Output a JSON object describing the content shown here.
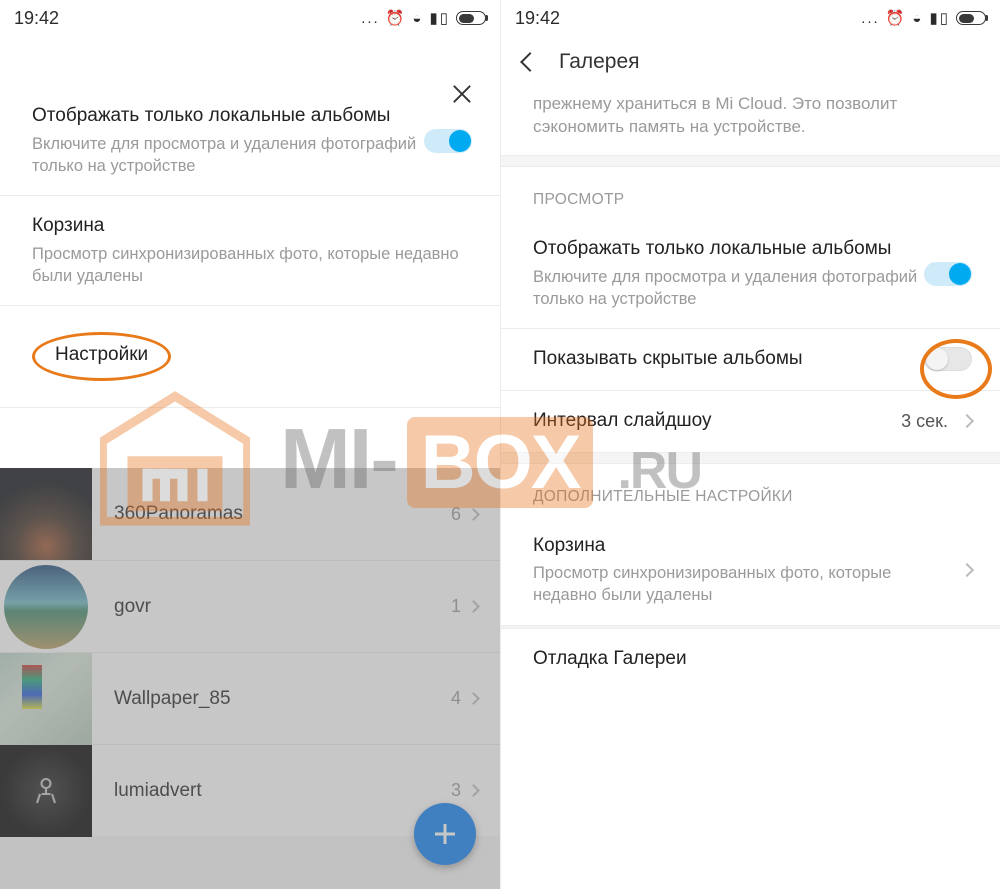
{
  "status_time": "19:42",
  "left": {
    "close_label": "Закрыть",
    "items": {
      "local": {
        "title": "Отображать только локальные альбомы",
        "sub": "Включите для просмотра и удаления фотографий только на устройстве",
        "on": true
      },
      "trash": {
        "title": "Корзина",
        "sub": "Просмотр синхронизированных фото, которые недавно были удалены"
      },
      "settings": {
        "title": "Настройки"
      }
    },
    "albums": [
      {
        "name": "360Panoramas",
        "count": "6"
      },
      {
        "name": "govr",
        "count": "1"
      },
      {
        "name": "Wallpaper_85",
        "count": "4"
      },
      {
        "name": "lumiadvert",
        "count": "3"
      }
    ]
  },
  "right": {
    "title": "Галерея",
    "faded_text": "прежнему храниться в Mi Cloud. Это позволит сэкономить память на устройстве.",
    "sections": {
      "view": "ПРОСМОТР",
      "advanced": "ДОПОЛНИТЕЛЬНЫЕ НАСТРОЙКИ"
    },
    "items": {
      "local": {
        "title": "Отображать только локальные альбомы",
        "sub": "Включите для просмотра и удаления фотографий только на устройстве",
        "on": true
      },
      "hidden": {
        "title": "Показывать скрытые альбомы",
        "on": false
      },
      "slideshow": {
        "title": "Интервал слайдшоу",
        "value": "3 сек."
      },
      "trash": {
        "title": "Корзина",
        "sub": "Просмотр синхронизированных фото, которые недавно были удалены"
      },
      "debug": {
        "title": "Отладка Галереи"
      }
    }
  },
  "watermark": {
    "text_mi": "MI-",
    "text_box": "BOX",
    "text_ru": ".RU"
  }
}
